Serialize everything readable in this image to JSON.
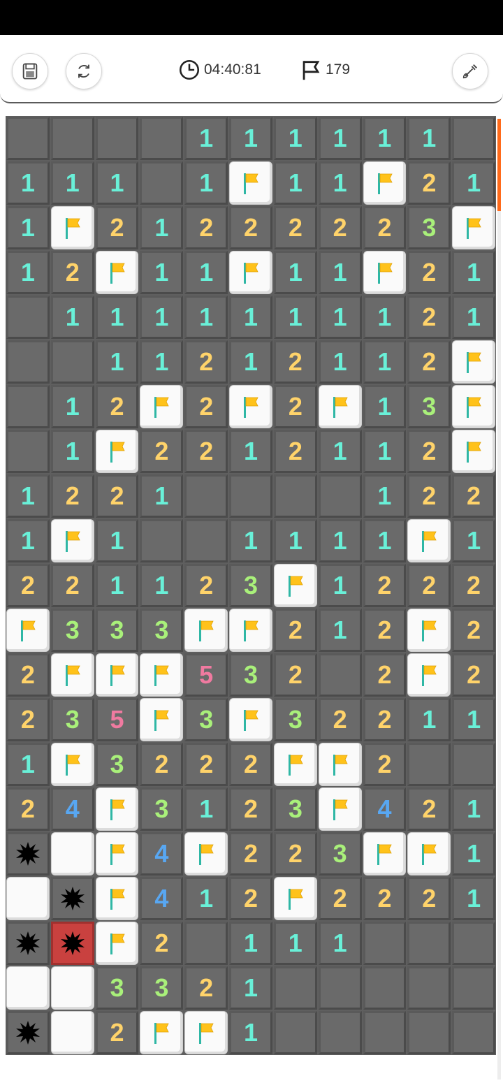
{
  "header": {
    "timer": "04:40:81",
    "flags_remaining": "179",
    "icons": {
      "save": "save-icon",
      "restart": "restart-icon",
      "timer": "clock-icon",
      "flags": "flag-outline-icon",
      "shovel": "shovel-icon"
    }
  },
  "colors": {
    "n1": "#69f0d8",
    "n2": "#ffd36a",
    "n3": "#a9f07a",
    "n4": "#58a7f2",
    "n5": "#f07aa0",
    "explode": "#c9413f",
    "scroll_thumb": "#ff6a1a"
  },
  "board": {
    "legend": "E=unrevealed-dark, F=flag, W=white-revealed-empty, M=mine, X=exploded-mine, digit=number",
    "rows": [
      "EEEE111111E",
      "111E1F11F21",
      "1F21222223F",
      "12F11F11F21",
      "E1111111121",
      "EE11212112F",
      "E12F2F2F13F",
      "E1F22121 12F",
      "1221EEEE122",
      "1F1EE1111F1",
      "221123F1222",
      "F333FF212F2",
      "2FFF532E2F2",
      "235F3F32211",
      "1F3222FF2EE",
      "24F3123F421",
      "MWF4F223FF1",
      "WMF412F2221",
      "MXF2E111EEE",
      "WW3321EEEEE",
      "MW2FF1EEEEE"
    ]
  }
}
